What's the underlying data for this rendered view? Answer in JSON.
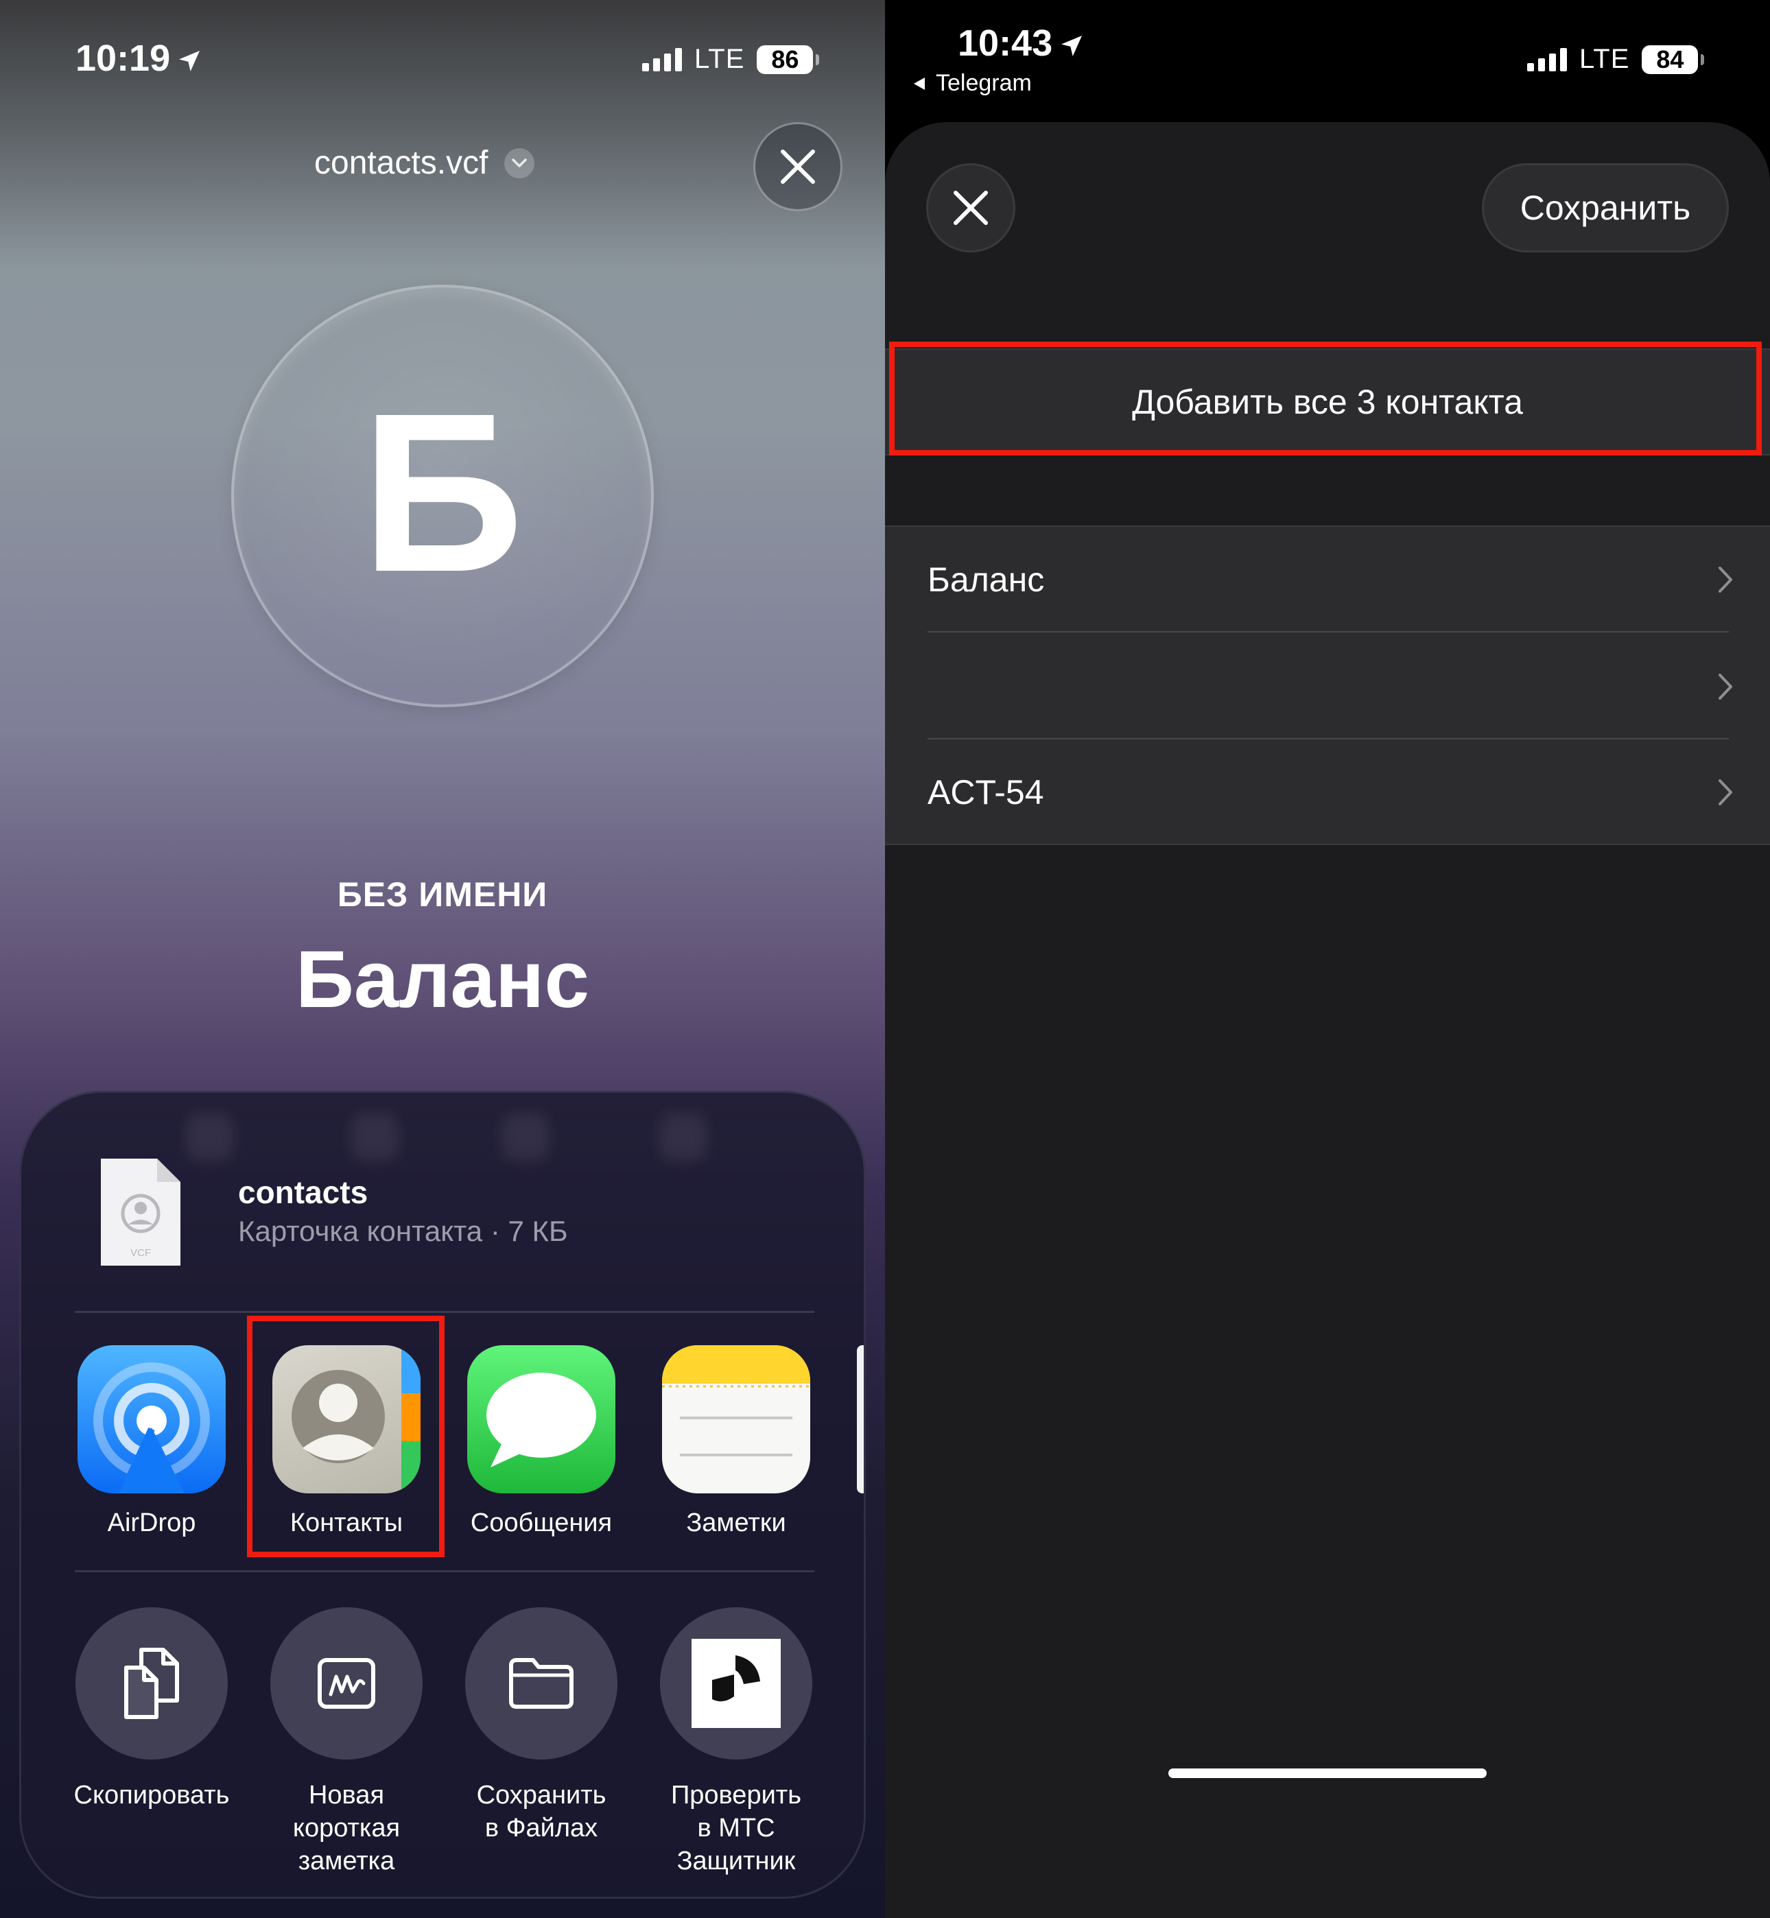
{
  "left": {
    "status": {
      "time": "10:19",
      "network": "LTE",
      "battery": "86"
    },
    "header": {
      "title": "contacts.vcf"
    },
    "contact": {
      "initial": "Б",
      "caption": "БЕЗ ИМЕНИ",
      "name": "Баланс"
    },
    "share_sheet": {
      "file": {
        "name": "contacts",
        "subtitle": "Карточка контакта · 7 КБ",
        "icon_tag": "VCF"
      },
      "apps": [
        {
          "label": "AirDrop",
          "icon": "airdrop-icon"
        },
        {
          "label": "Контакты",
          "icon": "contacts-icon",
          "highlighted": true
        },
        {
          "label": "Сообщения",
          "icon": "messages-icon"
        },
        {
          "label": "Заметки",
          "icon": "notes-icon"
        }
      ],
      "actions": [
        {
          "label": "Скопировать",
          "icon": "copy-icon"
        },
        {
          "label": "Новая\nкороткая\nзаметка",
          "icon": "quick-note-icon"
        },
        {
          "label": "Сохранить\nв Файлах",
          "icon": "folder-icon"
        },
        {
          "label": "Проверить\nв МТС\nЗащитник",
          "icon": "mts-defender-icon"
        }
      ]
    }
  },
  "right": {
    "status": {
      "time": "10:43",
      "network": "LTE",
      "battery": "84",
      "back_app": "Telegram"
    },
    "header": {
      "save_label": "Сохранить"
    },
    "add_all_label": "Добавить все 3 контакта",
    "contacts": [
      {
        "label": "Баланс"
      },
      {
        "label": ""
      },
      {
        "label": "ACT-54"
      }
    ]
  },
  "colors": {
    "highlight": "#f01c10",
    "airdrop_blue": "#1a8cff",
    "messages_green": "#34c759",
    "notes_yellow": "#ffd52e"
  }
}
